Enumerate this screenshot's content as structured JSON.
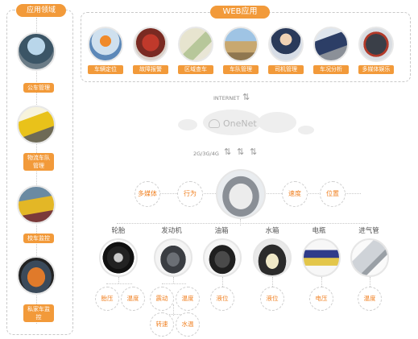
{
  "left_panel": {
    "title": "应用领域",
    "items": [
      {
        "label": "公车管理"
      },
      {
        "label": "物流车队管理"
      },
      {
        "label": "校车监控"
      },
      {
        "label": "私家车监控"
      }
    ]
  },
  "web_panel": {
    "title": "WEB应用",
    "items": [
      {
        "label": "车辆定位"
      },
      {
        "label": "故障报警"
      },
      {
        "label": "区域查车"
      },
      {
        "label": "车队管理"
      },
      {
        "label": "司机管理"
      },
      {
        "label": "车况分析"
      },
      {
        "label": "多媒体娱乐"
      }
    ]
  },
  "network": {
    "internet_label": "INTERNET",
    "cloud_label": "OneNet",
    "mobile_label": "2G/3G/4G"
  },
  "center": {
    "left_nodes": [
      "多媒体",
      "行为"
    ],
    "right_nodes": [
      "速度",
      "位置"
    ]
  },
  "components": [
    {
      "label": "轮胎",
      "params": [
        "胎压",
        "温度"
      ]
    },
    {
      "label": "发动机",
      "params": [
        "震动",
        "温度",
        "转速",
        "水温"
      ]
    },
    {
      "label": "油箱",
      "params": [
        "液位"
      ]
    },
    {
      "label": "水箱",
      "params": [
        "液位"
      ]
    },
    {
      "label": "电瓶",
      "params": [
        "电压"
      ]
    },
    {
      "label": "进气管",
      "params": [
        "温度"
      ]
    }
  ],
  "colors": {
    "accent": "#f29a3a",
    "node_text": "#f07f1f",
    "line": "#c9c9c9"
  }
}
